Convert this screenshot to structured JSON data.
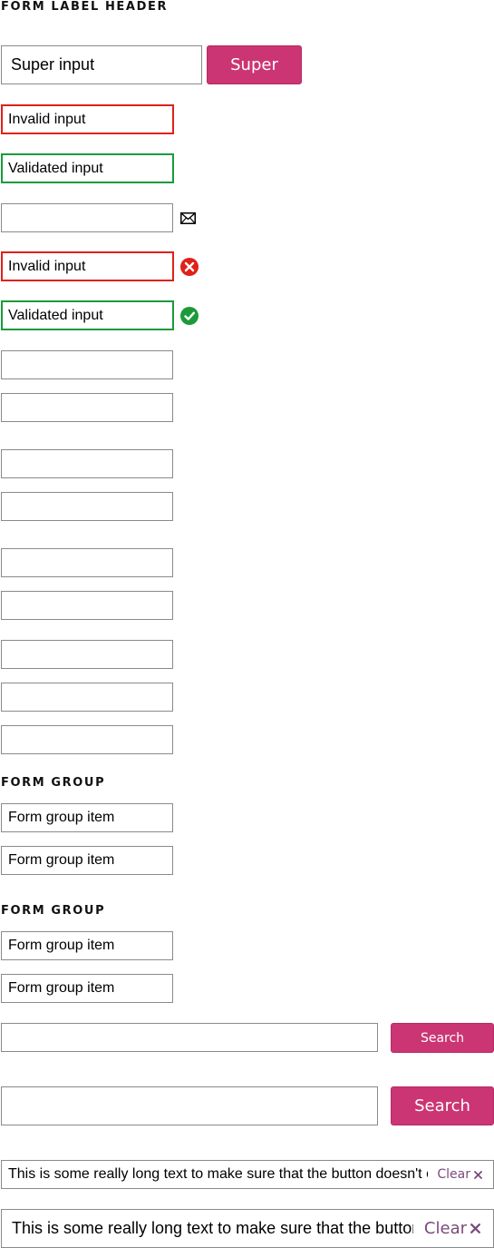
{
  "header": {
    "title": "FORM LABEL HEADER"
  },
  "super": {
    "value": "Super input",
    "button_label": "Super"
  },
  "validation": {
    "invalid_value": "Invalid input",
    "valid_value": "Validated input"
  },
  "icon_inputs": {
    "email_icon": "envelope-icon",
    "invalid_value": "Invalid input",
    "invalid_icon": "error-x-icon",
    "valid_value": "Validated input",
    "valid_icon": "check-circle-icon"
  },
  "form_groups": [
    {
      "title": "FORM GROUP",
      "items": [
        "Form group item",
        "Form group item"
      ]
    },
    {
      "title": "FORM GROUP",
      "items": [
        "Form group item",
        "Form group item"
      ]
    }
  ],
  "search": {
    "small_button": "Search",
    "large_button": "Search"
  },
  "clearable": {
    "small_text": "This is some really long text to make sure that the button doesn't overlap",
    "small_clear": "Clear",
    "large_text": "This is some really long text to make sure that the button doesn't overlap",
    "large_clear": "Clear"
  },
  "colors": {
    "accent": "#cb3573",
    "invalid": "#e0201b",
    "valid": "#1c9a3a",
    "clear": "#7b4a7e"
  }
}
